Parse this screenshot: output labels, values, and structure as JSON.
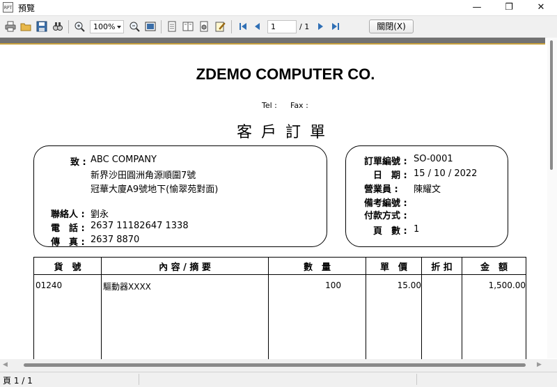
{
  "window": {
    "title": "預覽",
    "app_icon_text": "RPT",
    "minimize": "—",
    "maximize": "❐",
    "close": "✕"
  },
  "toolbar": {
    "zoom": "100%",
    "page_current": "1",
    "page_total": "/ 1",
    "close_label": "關閉(X)"
  },
  "colors": {
    "header_bar": "#727272",
    "accent_line": "#c9a13c"
  },
  "report": {
    "company": "ZDEMO COMPUTER CO.",
    "tel_label": "Tel :",
    "fax_label": "Fax :",
    "title": "客戶訂單",
    "customer": {
      "to_label": "致 :",
      "name": "ABC COMPANY",
      "address1": "新界沙田圓洲角源順圍7號",
      "address2": "冠華大廈A9號地下(愉翠苑對面)",
      "contact_label": "聯絡人 :",
      "contact": "劉永",
      "phone_label": "電　話 :",
      "phone": "2637 11182647 1338",
      "fax_label": "傳　真 :",
      "fax": "2637 8870"
    },
    "order": {
      "order_no_label": "訂單編號 :",
      "order_no": "SO-0001",
      "date_label": "日　期 :",
      "date": "15 / 10 / 2022",
      "sales_label": "營業員 :",
      "sales": "陳耀文",
      "ref_label": "備考編號 :",
      "payment_label": "付款方式 :",
      "pages_label": "頁　數 :",
      "pages": "1"
    },
    "table": {
      "headers": [
        "貨　號",
        "內 容 / 摘 要",
        "數　量",
        "單　價",
        "折 扣",
        "金　額"
      ],
      "rows": [
        {
          "code": "01240",
          "desc": "驅動器XXXX",
          "qty": "100",
          "price": "15.00",
          "discount": "",
          "amount": "1,500.00"
        }
      ]
    }
  },
  "status": {
    "text": "頁 1 / 1"
  }
}
